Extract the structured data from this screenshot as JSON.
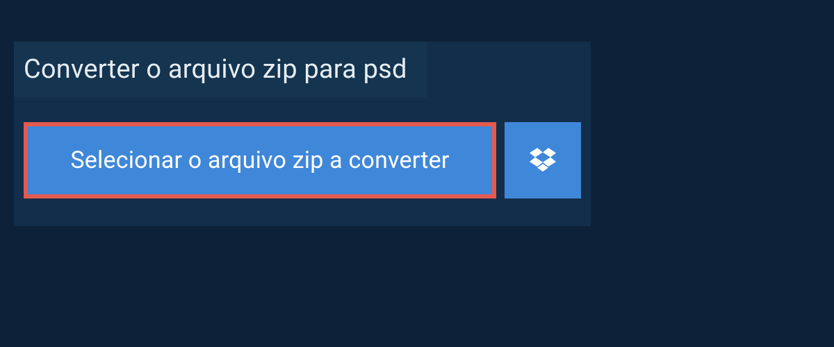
{
  "header": {
    "title": "Converter o arquivo zip para psd"
  },
  "actions": {
    "select_file_label": "Selecionar o arquivo zip a converter",
    "dropbox_icon": "dropbox-icon"
  },
  "colors": {
    "page_bg": "#0d2238",
    "card_bg": "#132e4a",
    "tab_bg": "#153450",
    "button_bg": "#3f87d9",
    "highlight_border": "#e55a4f",
    "text": "#ffffff"
  }
}
